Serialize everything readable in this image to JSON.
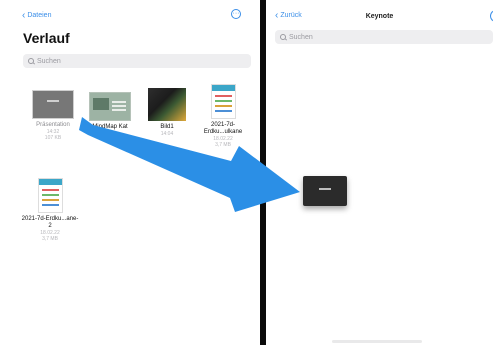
{
  "left_pane": {
    "back_label": "Dateien",
    "title": "Verlauf",
    "search_placeholder": "Suchen",
    "files": [
      {
        "name": "Präsentation",
        "date": "14:32",
        "size": "107 KB",
        "thumb": "presentation",
        "dimmed": true
      },
      {
        "name": "MindMap Kat",
        "date": "16:05",
        "size": "5,8 MB",
        "thumb": "mindmap",
        "dimmed": false
      },
      {
        "name": "Bild1",
        "date": "14:04",
        "size": "",
        "thumb": "image",
        "dimmed": false
      },
      {
        "name": "2021-7d-Erdku...ulkane",
        "date": "18.02.22",
        "size": "3,7 MB",
        "thumb": "document",
        "dimmed": false
      },
      {
        "name": "2021-7d-Erdku...ane-2",
        "date": "18.02.22",
        "size": "3,7 MB",
        "thumb": "document",
        "dimmed": false
      }
    ]
  },
  "right_pane": {
    "back_label": "Zurück",
    "title": "Keynote",
    "search_placeholder": "Suchen"
  },
  "drag": {
    "arrow_color": "#2b8fe6",
    "item": "presentation-thumbnail"
  },
  "icons": {
    "back": "chevron-left-icon",
    "more": "ellipsis-circle-icon",
    "search": "magnifying-glass-icon"
  },
  "colors": {
    "accent": "#3a8ee8",
    "divider": "#0b0b0b"
  }
}
